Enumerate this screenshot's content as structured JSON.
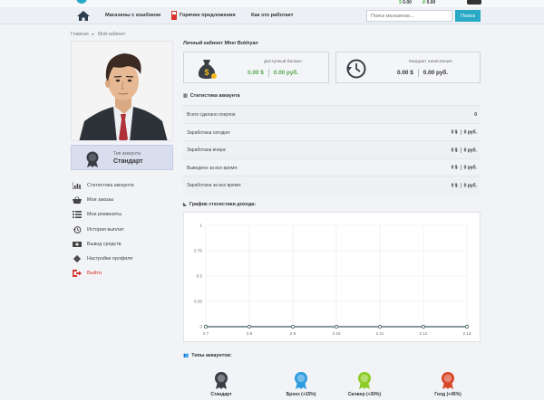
{
  "topbar": {
    "balance_1": "0.00",
    "balance_2": "0.00"
  },
  "nav": {
    "links": [
      "Магазины с кэшбэком",
      "Горячие предложения",
      "Как это работает"
    ],
    "search_placeholder": "Поиск магазинов...",
    "search_button": "Поиск"
  },
  "breadcrumb": {
    "home": "Главная",
    "current": "Мой кабинет"
  },
  "account": {
    "type_label": "Тип аккаунта",
    "type_value": "Стандарт"
  },
  "menu": [
    {
      "label": "Статистика аккаунта",
      "icon": "bar-chart-icon"
    },
    {
      "label": "Мои заказы",
      "icon": "basket-icon"
    },
    {
      "label": "Мои реквизиты",
      "icon": "list-icon"
    },
    {
      "label": "История выплат",
      "icon": "history-icon"
    },
    {
      "label": "Вывод средств",
      "icon": "money-icon"
    },
    {
      "label": "Настройки профиля",
      "icon": "gear-icon"
    },
    {
      "label": "Выйти",
      "icon": "logout-icon"
    }
  ],
  "cabinet": {
    "title": "Личный кабинет Mher Bokhyan",
    "available_label": "Доступный баланс:",
    "available_usd": "0.00 $",
    "available_rub": "0.00 руб.",
    "pending_label": "Ожидает начисления:",
    "pending_usd": "0.00 $",
    "pending_rub": "0.00 руб."
  },
  "stats": {
    "title": "Статистика аккаунта",
    "rows": [
      {
        "label": "Всего сделано покупок:",
        "usd": "0",
        "rub": ""
      },
      {
        "label": "Заработана сегодня:",
        "usd": "0 $",
        "rub": "0 руб."
      },
      {
        "label": "Заработана вчера:",
        "usd": "0 $",
        "rub": "0 руб."
      },
      {
        "label": "Выведено за все время:",
        "usd": "0 $",
        "rub": "0 руб."
      },
      {
        "label": "Заработана за все время:",
        "usd": "0 $",
        "rub": "0 руб."
      }
    ]
  },
  "chart_title": "График статистики дохода:",
  "chart_data": {
    "type": "line",
    "x": [
      "2.7",
      "2.8",
      "2.9",
      "2.10",
      "2.11",
      "2.12",
      "2.13"
    ],
    "series": [
      {
        "values": [
          0,
          0,
          0,
          0,
          0,
          0,
          0
        ]
      }
    ],
    "yticks": [
      "0",
      "0.25",
      "0.5",
      "0.75",
      "1"
    ],
    "ylim": [
      0,
      1
    ],
    "grid": true,
    "line_color": "#3f5a5f"
  },
  "types": {
    "title": "Типы аккаунтов:",
    "items": [
      {
        "label": "Стандарт",
        "color": "#3a3f45"
      },
      {
        "label": "Бронз (+15%)",
        "color": "#2f9be0"
      },
      {
        "label": "Силвер (+30%)",
        "color": "#8ccc25"
      },
      {
        "label": "Голд (+45%)",
        "color": "#d7482a"
      }
    ]
  },
  "colors": {
    "accent": "#29a9c5",
    "green": "#55a84a",
    "logout": "#d9342b"
  }
}
